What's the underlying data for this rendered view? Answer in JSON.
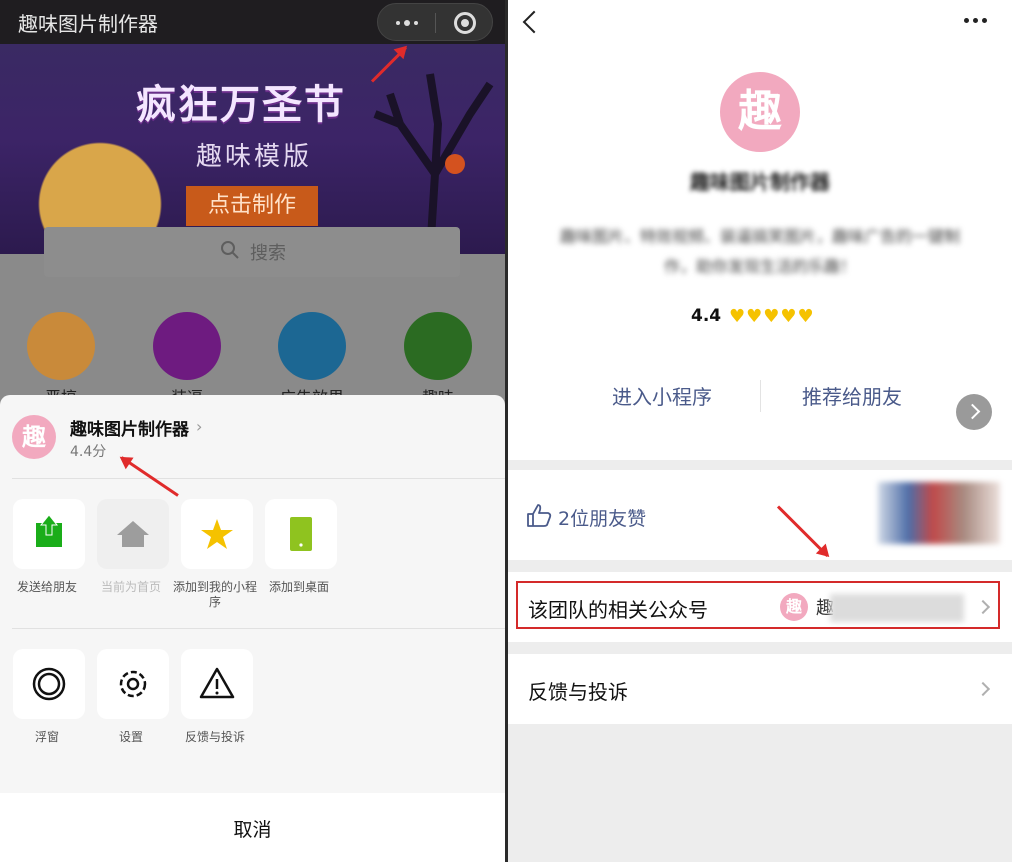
{
  "left": {
    "app_title": "趣味图片制作器",
    "banner": {
      "title": "疯狂万圣节",
      "subtitle": "趣味模版",
      "button": "点击制作"
    },
    "search": {
      "placeholder": "搜索"
    },
    "categories": [
      {
        "label": "恶搞",
        "color": "#f29a2e"
      },
      {
        "label": "装逼",
        "color": "#9c1fb5"
      },
      {
        "label": "广告效果",
        "color": "#1d8fd1"
      },
      {
        "label": "趣味",
        "color": "#3a9a2a"
      }
    ],
    "sheet": {
      "app_logo_char": "趣",
      "app_name": "趣味图片制作器",
      "app_score": "4.4分",
      "row1": [
        {
          "label": "发送给朋友",
          "icon": "share-icon"
        },
        {
          "label": "当前为首页",
          "icon": "home-icon"
        },
        {
          "label": "添加到我的小程序",
          "icon": "star-icon"
        },
        {
          "label": "添加到桌面",
          "icon": "desktop-icon"
        }
      ],
      "row2": [
        {
          "label": "浮窗",
          "icon": "float-window-icon"
        },
        {
          "label": "设置",
          "icon": "settings-icon"
        },
        {
          "label": "反馈与投诉",
          "icon": "warning-icon"
        }
      ],
      "cancel": "取消"
    }
  },
  "right": {
    "logo_char": "趣",
    "app_name": "趣味图片制作器",
    "description": "趣味图片、特效视频、装逼搞笑图片，趣味广告的一键制作，助你发现生活的乐趣！",
    "rating": "4.4",
    "rating_value": 4.4,
    "rating_max": 5,
    "enter_button": "进入小程序",
    "recommend_button": "推荐给朋友",
    "likes": "2位朋友赞",
    "related_account_label": "该团队的相关公众号",
    "related_account_char": "趣",
    "related_account_name": "趣",
    "feedback_label": "反馈与投诉"
  },
  "colors": {
    "accent": "#4a5a8a",
    "highlight_box": "#d42a2a",
    "app_logo": "#f2a9bf",
    "star": "#f5c200"
  }
}
